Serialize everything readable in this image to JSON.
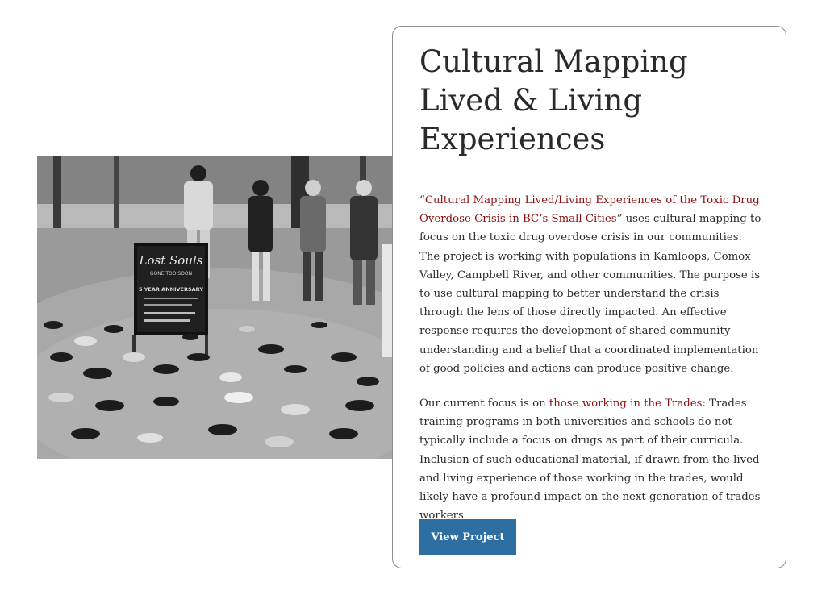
{
  "project": {
    "title": "Cultural Mapping Lived & Living Experiences",
    "intro_quote_open": "“",
    "intro_link": "Cultural Mapping Lived/Living Experiences of the Toxic Drug Overdose Crisis in BC’s Small Cities",
    "intro_rest": "” uses cultural mapping to focus on the toxic drug overdose crisis in our communities. The project is working with populations in Kamloops, Comox Valley, Campbell River, and other communities. The purpose is to use cultural mapping to better understand the crisis through the lens of those directly impacted. An effective response requires the development of shared community understanding and a belief that a coordinated implementation of good policies and actions can produce positive change.",
    "focus_prefix": "Our current focus is on ",
    "focus_link": "those working in the Trades",
    "focus_rest": ": Trades training programs in both universities and schools do not typically include a focus on drugs as part of their curricula. Inclusion of such educational material, if drawn from the lived and living experience of those working in the trades, would likely have a profound impact on the next generation of trades workers",
    "button_label": "View Project"
  },
  "photo": {
    "sign_title": "Lost Souls",
    "sign_subtitle": "GONE TOO SOON",
    "sign_line": "5 YEAR ANNIVERSARY"
  },
  "colors": {
    "link": "#8c1010",
    "button": "#2e6fa3",
    "border": "#8e8e8e"
  }
}
